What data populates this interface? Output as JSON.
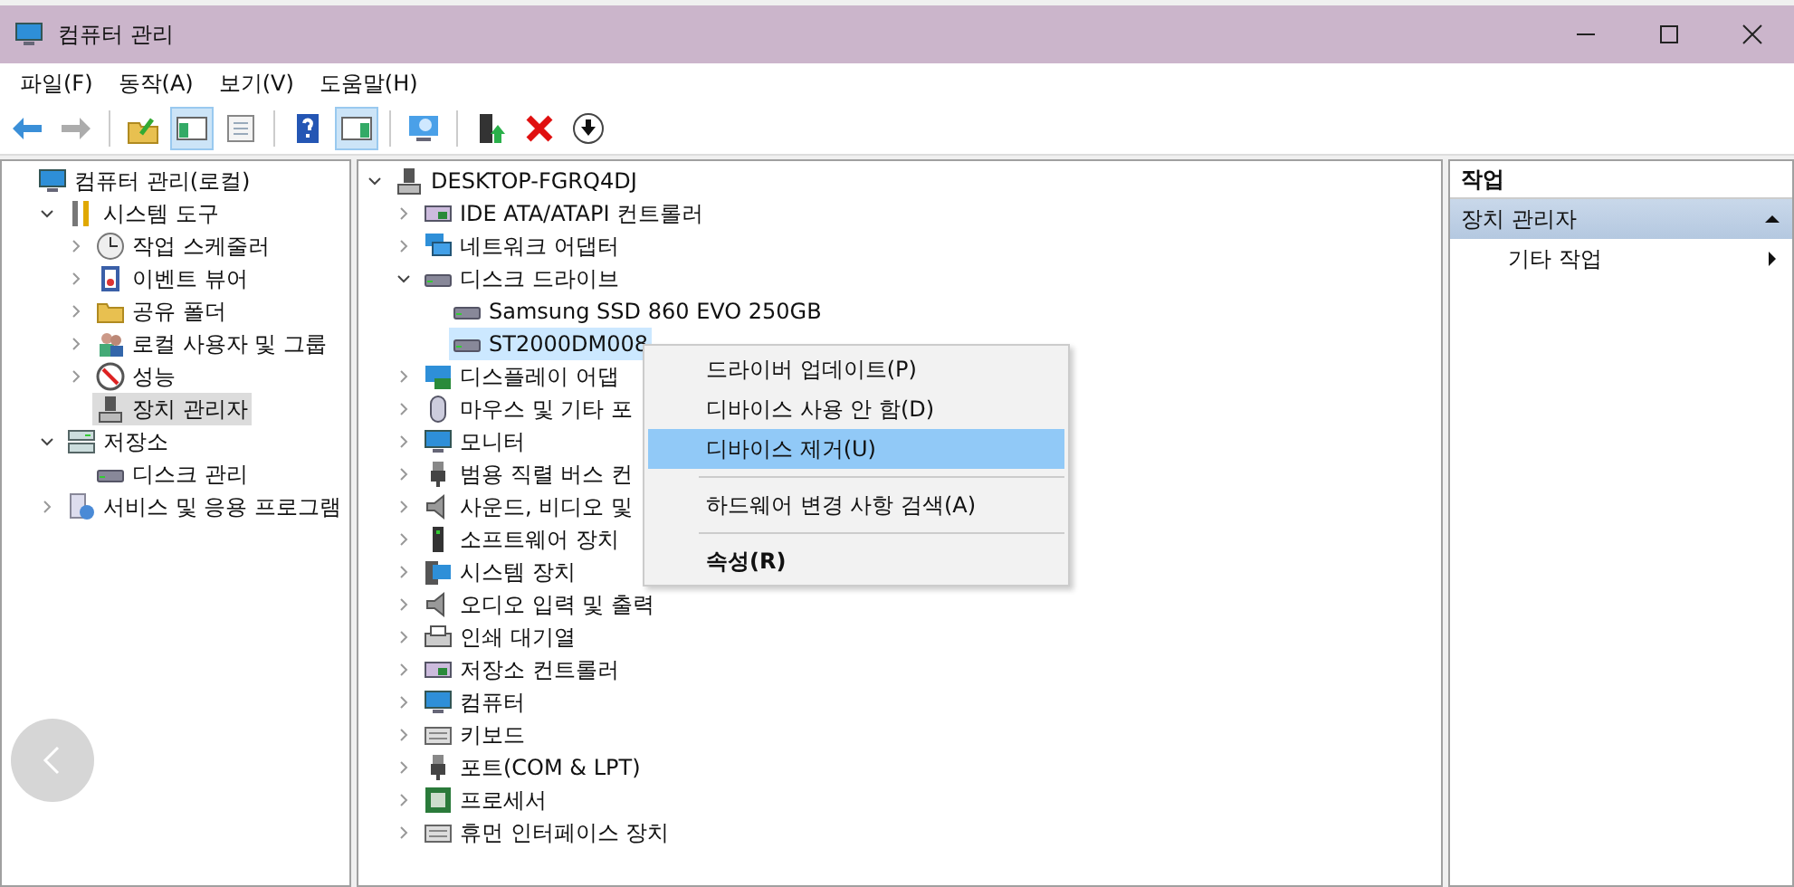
{
  "window": {
    "title": "컴퓨터 관리"
  },
  "menu_bar": [
    "파일(F)",
    "동작(A)",
    "보기(V)",
    "도움말(H)"
  ],
  "toolbar": [
    {
      "pressed": false,
      "disabled": false
    },
    {
      "pressed": false,
      "disabled": true
    },
    {
      "pressed": false,
      "disabled": false
    },
    {
      "pressed": true,
      "disabled": false
    },
    {
      "pressed": false,
      "disabled": false
    },
    {
      "pressed": false,
      "disabled": false
    },
    {
      "pressed": true,
      "disabled": false
    },
    {
      "pressed": false,
      "disabled": false
    },
    {
      "pressed": false,
      "disabled": false
    },
    {
      "pressed": false,
      "disabled": false
    },
    {
      "pressed": false,
      "disabled": false
    }
  ],
  "console_tree": [
    {
      "label": "컴퓨터 관리(로컬)",
      "selected": false,
      "children": [
        {
          "label": "시스템 도구",
          "selected": false,
          "expanded": true,
          "children": [
            {
              "label": "작업 스케줄러",
              "selected": false,
              "expanded": false
            },
            {
              "label": "이벤트 뷰어",
              "selected": false,
              "expanded": false
            },
            {
              "label": "공유 폴더",
              "selected": false,
              "expanded": false
            },
            {
              "label": "로컬 사용자 및 그룹",
              "selected": false,
              "expanded": false
            },
            {
              "label": "성능",
              "selected": false,
              "expanded": false
            },
            {
              "label": "장치 관리자",
              "selected": true
            }
          ]
        },
        {
          "label": "저장소",
          "selected": false,
          "expanded": true,
          "children": [
            {
              "label": "디스크 관리",
              "selected": false
            }
          ]
        },
        {
          "label": "서비스 및 응용 프로그램",
          "selected": false,
          "expanded": false
        }
      ]
    }
  ],
  "device_tree": [
    {
      "label": "DESKTOP-FGRQ4DJ",
      "selected": false,
      "expanded": true,
      "children": [
        {
          "label": "IDE ATA/ATAPI 컨트롤러",
          "selected": false,
          "expanded": false
        },
        {
          "label": "네트워크 어댑터",
          "selected": false,
          "expanded": false
        },
        {
          "label": "디스크 드라이브",
          "selected": false,
          "expanded": true,
          "children": [
            {
              "label": "Samsung SSD 860 EVO 250GB",
              "selected": false
            },
            {
              "label": "ST2000DM008",
              "selected": true
            }
          ]
        },
        {
          "label": "디스플레이 어댑",
          "selected": false,
          "expanded": false
        },
        {
          "label": "마우스 및 기타 포",
          "selected": false,
          "expanded": false
        },
        {
          "label": "모니터",
          "selected": false,
          "expanded": false
        },
        {
          "label": "범용 직렬 버스 컨",
          "selected": false,
          "expanded": false
        },
        {
          "label": "사운드, 비디오 및",
          "selected": false,
          "expanded": false
        },
        {
          "label": "소프트웨어 장치",
          "selected": false,
          "expanded": false
        },
        {
          "label": "시스템 장치",
          "selected": false,
          "expanded": false
        },
        {
          "label": "오디오 입력 및 출력",
          "selected": false,
          "expanded": false
        },
        {
          "label": "인쇄 대기열",
          "selected": false,
          "expanded": false
        },
        {
          "label": "저장소 컨트롤러",
          "selected": false,
          "expanded": false
        },
        {
          "label": "컴퓨터",
          "selected": false,
          "expanded": false
        },
        {
          "label": "키보드",
          "selected": false,
          "expanded": false
        },
        {
          "label": "포트(COM & LPT)",
          "selected": false,
          "expanded": false
        },
        {
          "label": "프로세서",
          "selected": false,
          "expanded": false
        },
        {
          "label": "휴먼 인터페이스 장치",
          "selected": false,
          "expanded": false
        }
      ]
    }
  ],
  "context_menu": {
    "groups": [
      {
        "items": [
          {
            "label": "드라이버 업데이트(P)",
            "selected": false,
            "default": false
          },
          {
            "label": "디바이스 사용 안 함(D)",
            "selected": false,
            "default": false
          },
          {
            "label": "디바이스 제거(U)",
            "selected": true,
            "default": false
          }
        ]
      },
      {
        "items": [
          {
            "label": "하드웨어 변경 사항 검색(A)",
            "selected": false,
            "default": false
          }
        ]
      },
      {
        "items": [
          {
            "label": "속성(R)",
            "selected": false,
            "default": true
          }
        ]
      }
    ]
  },
  "actions": {
    "header": "작업",
    "sections": [
      {
        "title": "장치 관리자",
        "expanded": true,
        "items": [
          {
            "label": "기타 작업"
          }
        ]
      }
    ]
  }
}
